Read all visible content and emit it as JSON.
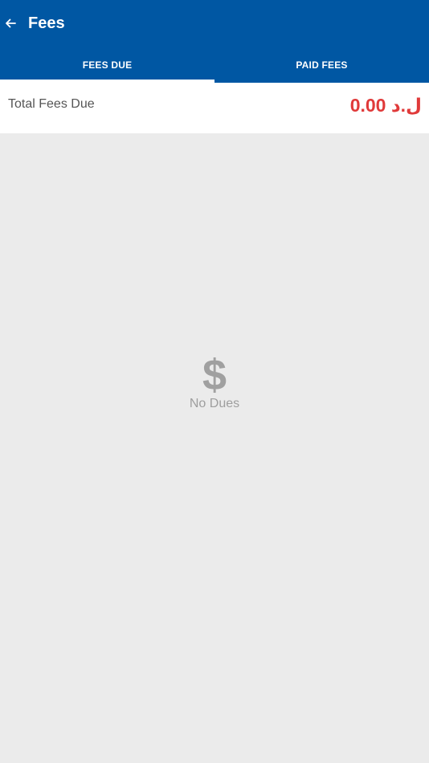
{
  "header": {
    "title": "Fees"
  },
  "tabs": [
    {
      "label": "FEES DUE",
      "selected": true
    },
    {
      "label": "PAID FEES",
      "selected": false
    }
  ],
  "summary": {
    "label": "Total Fees Due",
    "amount": "0.00 ل.د"
  },
  "empty_state": {
    "icon": "dollar-icon",
    "message": "No Dues"
  },
  "colors": {
    "primary": "#0057a3",
    "amount": "#e03a3a",
    "background": "#ebebeb"
  }
}
